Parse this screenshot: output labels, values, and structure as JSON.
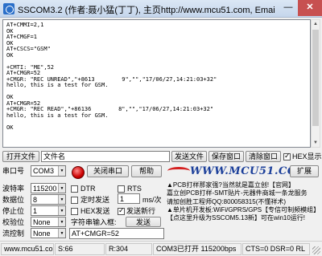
{
  "window": {
    "title": "SSCOM3.2 (作者:聂小猛(丁丁), 主页http://www.mcu51.com,  Email: mc",
    "minimize": "—",
    "close": "✕"
  },
  "output": {
    "lines": [
      "AT+CMMI=2,1",
      "OK",
      "AT+CMGF=1",
      "OK",
      "AT+CSCS=\"GSM\"",
      "OK",
      "",
      "+CMTI: \"ME\",52",
      "AT+CMGR=52",
      "+CMGR: \"REC UNREAD\",\"+8613        9\",\"\",\"17/06/27,14:21:03+32\"",
      "hello, this is a test for GSM.",
      "",
      "OK",
      "AT+CMGR=52",
      "+CMGR: \"REC READ\",\"+86136        8\",\"\",\"17/06/27,14:21:03+32\"",
      "hello, this is a test for GSM.",
      "",
      "OK"
    ]
  },
  "filerow": {
    "open_file": "打开文件",
    "filename": "文件名",
    "send_file": "发送文件",
    "save_window": "保存窗口",
    "clear_window": "清除窗口",
    "hex_display": "HEX显示",
    "hex_display_checked": true
  },
  "portrow": {
    "port_label": "串口号",
    "port_value": "COM3",
    "close_port": "关闭串口",
    "help": "帮助",
    "expand": "扩展"
  },
  "banner": {
    "text": "WWW.MCU51.COM"
  },
  "settings": {
    "baud_label": "波特率",
    "baud_value": "115200",
    "databits_label": "数据位",
    "databits_value": "8",
    "stopbits_label": "停止位",
    "stopbits_value": "1",
    "parity_label": "校验位",
    "parity_value": "None",
    "flow_label": "流控制",
    "flow_value": "None"
  },
  "options": {
    "dtr": "DTR",
    "dtr_checked": false,
    "rts": "RTS",
    "rts_checked": false,
    "timed_send": "定时发送",
    "timed_send_checked": false,
    "interval_value": "1",
    "interval_unit": "ms/次",
    "hex_send": "HEX发送",
    "hex_send_checked": false,
    "send_newline": "发送新行",
    "send_newline_checked": true,
    "input_label": "字符串输入框:",
    "send_button": "发送",
    "input_value": "AT+CMGR=52"
  },
  "ad": {
    "lines": [
      "▲PCB打样那家强?当然就是嘉立创!【官网】",
      "嘉立创PCB打样-SMT贴片-元器件商城一条龙服务",
      "请加创胜工程师QQ:800058315(不懂祥术)",
      "▲单片机开发板:WiFi/GPRS/GPS【专信可制频模组】",
      "【点这里升级为SSCOM5.13新】可在win10运行!"
    ]
  },
  "status": {
    "website": "www.mcu51.cor",
    "sent": "S:66",
    "received": "R:304",
    "port_state": "COM3已打开  115200bps",
    "signals": "CTS=0 DSR=0 RL"
  }
}
